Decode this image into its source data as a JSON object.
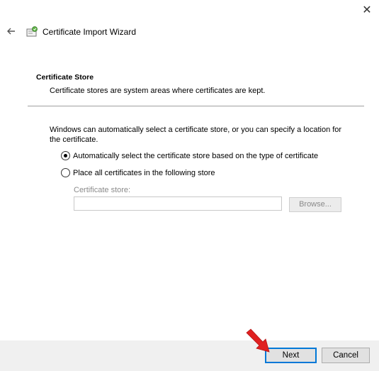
{
  "window": {
    "title": "Certificate Import Wizard",
    "close_glyph": "✕",
    "back_icon": "back-arrow-icon",
    "wizard_icon": "certificate-icon"
  },
  "section": {
    "title": "Certificate Store",
    "description": "Certificate stores are system areas where certificates are kept."
  },
  "body": {
    "intro": "Windows can automatically select a certificate store, or you can specify a location for the certificate.",
    "options": [
      {
        "label": "Automatically select the certificate store based on the type of certificate",
        "checked": true
      },
      {
        "label": "Place all certificates in the following store",
        "checked": false
      }
    ],
    "store_label": "Certificate store:",
    "store_value": "",
    "browse_label": "Browse..."
  },
  "footer": {
    "next_label": "Next",
    "cancel_label": "Cancel"
  },
  "colors": {
    "accent": "#0078d7",
    "annotation_arrow": "#e02020"
  }
}
